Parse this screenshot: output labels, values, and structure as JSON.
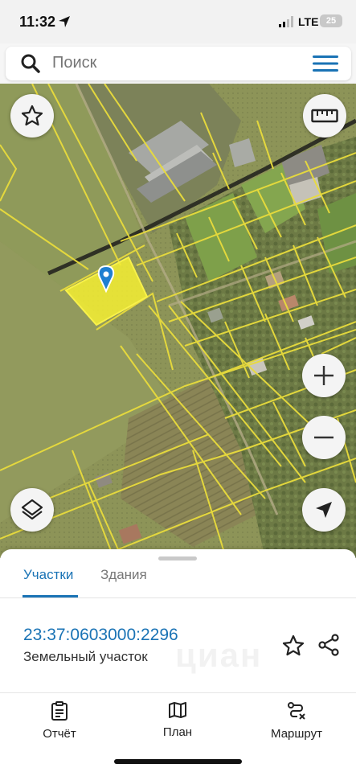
{
  "status_bar": {
    "time": "11:32",
    "network": "LTE",
    "battery": "25"
  },
  "search": {
    "placeholder": "Поиск"
  },
  "map": {
    "selected_plot_color": "#f5ef33",
    "parcel_line_color": "#e9dc3c",
    "marker_color": "#1e7fd1",
    "controls": [
      "favorite",
      "ruler",
      "zoom-in",
      "zoom-out",
      "layers",
      "my-location"
    ]
  },
  "sheet": {
    "tabs": [
      {
        "label": "Участки",
        "active": true
      },
      {
        "label": "Здания",
        "active": false
      }
    ],
    "cadastral_number": "23:37:0603000:2296",
    "plot_type": "Земельный участок",
    "watermark": "циан"
  },
  "tabbar": {
    "items": [
      {
        "label": "Отчёт",
        "icon": "report-icon"
      },
      {
        "label": "План",
        "icon": "map-icon"
      },
      {
        "label": "Маршрут",
        "icon": "route-icon"
      }
    ]
  },
  "colors": {
    "accent": "#1a73b5",
    "text": "#222222"
  }
}
